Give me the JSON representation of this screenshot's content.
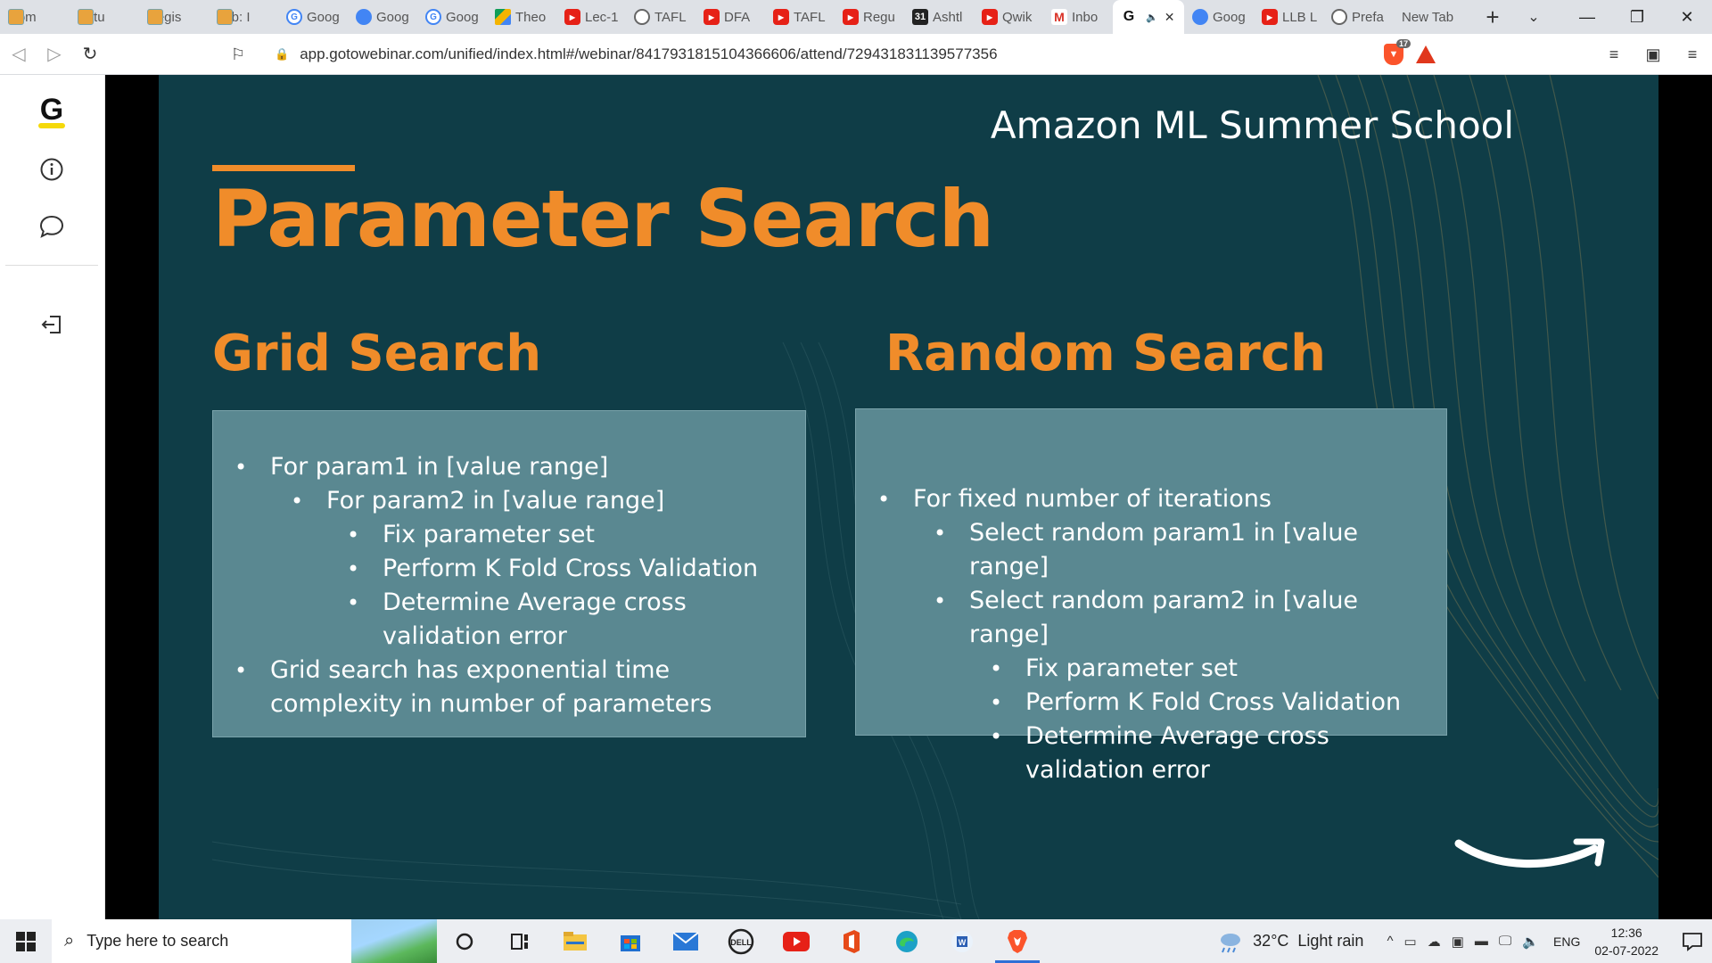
{
  "browser": {
    "tabs": [
      {
        "label": "Hom",
        "icon": "box-icon"
      },
      {
        "label": "Virtu",
        "icon": "box-icon"
      },
      {
        "label": "Regis",
        "icon": "box-icon"
      },
      {
        "label": "Lab: I",
        "icon": "box-icon"
      },
      {
        "label": "Goog",
        "icon": "google-icon"
      },
      {
        "label": "Goog",
        "icon": "google-cloud-icon"
      },
      {
        "label": "Goog",
        "icon": "google-icon"
      },
      {
        "label": "Theo",
        "icon": "google-drive-icon"
      },
      {
        "label": "Lec-1",
        "icon": "youtube-icon"
      },
      {
        "label": "TAFL",
        "icon": "globe-icon"
      },
      {
        "label": "DFA",
        "icon": "youtube-icon"
      },
      {
        "label": "TAFL",
        "icon": "youtube-icon"
      },
      {
        "label": "Regu",
        "icon": "youtube-icon"
      },
      {
        "label": "Ashtl",
        "icon": "number-icon"
      },
      {
        "label": "Qwik",
        "icon": "youtube-icon"
      },
      {
        "label": "Inbo",
        "icon": "gmail-icon"
      },
      {
        "label": "",
        "icon": "gotowebinar-icon",
        "active": true
      },
      {
        "label": "Goog",
        "icon": "google-cloud-icon"
      },
      {
        "label": "LLB L",
        "icon": "youtube-icon"
      },
      {
        "label": "Prefa",
        "icon": "globe-icon"
      },
      {
        "label": "New Tab",
        "icon": ""
      }
    ],
    "address": "app.gotowebinar.com/unified/index.html#/webinar/8417931815104366606/attend/729431831139577356",
    "brave_shield_count": "17"
  },
  "slide": {
    "brand": "Amazon ML Summer School",
    "title": "Parameter Search",
    "left": {
      "heading": "Grid Search",
      "bullets": [
        {
          "level": 1,
          "text": "For param1 in [value range]"
        },
        {
          "level": 2,
          "text": "For param2 in [value range]"
        },
        {
          "level": 3,
          "text": "Fix parameter set"
        },
        {
          "level": 3,
          "text": "Perform K Fold Cross Validation"
        },
        {
          "level": 3,
          "text": "Determine Average cross validation error"
        },
        {
          "level": 1,
          "text": "Grid search has exponential time complexity in number of parameters"
        }
      ]
    },
    "right": {
      "heading": "Random Search",
      "bullets": [
        {
          "level": 1,
          "text": "For fixed number of iterations"
        },
        {
          "level": 2,
          "text": "Select random param1 in [value range]"
        },
        {
          "level": 2,
          "text": "Select random param2 in [value range]"
        },
        {
          "level": 3,
          "text": "Fix parameter set"
        },
        {
          "level": 3,
          "text": "Perform K Fold Cross Validation"
        },
        {
          "level": 3,
          "text": "Determine Average cross validation error"
        }
      ]
    }
  },
  "taskbar": {
    "search_placeholder": "Type here to search",
    "weather_temp": "32°C",
    "weather_text": "Light rain",
    "language": "ENG",
    "time": "12:36",
    "date": "02-07-2022"
  }
}
